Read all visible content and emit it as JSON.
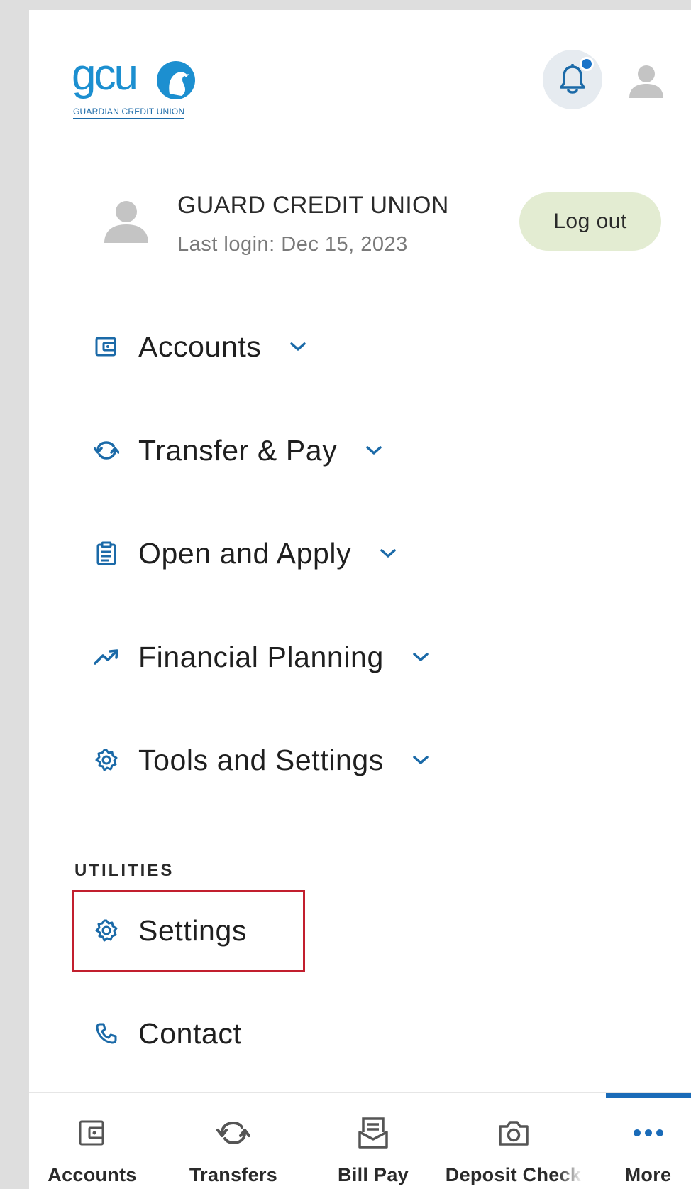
{
  "colors": {
    "brand_blue": "#1a73c8",
    "icon_blue": "#1b6aa8",
    "logout_bg": "#e3ecd2",
    "highlight_red": "#c21f2e"
  },
  "header": {
    "logo_text": "gcu",
    "logo_subtitle": "GUARDIAN CREDIT UNION",
    "notification_icon": "bell-icon",
    "profile_icon": "user-icon"
  },
  "profile": {
    "name": "GUARD CREDIT UNION",
    "last_login": "Last login: Dec 15, 2023",
    "logout_label": "Log out"
  },
  "menu": [
    {
      "label": "Accounts",
      "icon": "wallet-icon"
    },
    {
      "label": "Transfer & Pay",
      "icon": "transfer-icon"
    },
    {
      "label": "Open and Apply",
      "icon": "clipboard-icon"
    },
    {
      "label": "Financial Planning",
      "icon": "trending-up-icon"
    },
    {
      "label": "Tools and Settings",
      "icon": "gear-icon"
    }
  ],
  "utilities": {
    "title": "UTILITIES",
    "items": [
      {
        "label": "Settings",
        "icon": "gear-icon"
      },
      {
        "label": "Contact",
        "icon": "phone-icon"
      }
    ]
  },
  "bottom_nav": [
    {
      "label": "Accounts",
      "icon": "wallet-icon"
    },
    {
      "label": "Transfers",
      "icon": "transfer-icon"
    },
    {
      "label": "Bill Pay",
      "icon": "bill-icon"
    },
    {
      "label": "Deposit Check",
      "icon": "camera-icon"
    },
    {
      "label": "More",
      "icon": "more-dots-icon",
      "active": true
    }
  ]
}
